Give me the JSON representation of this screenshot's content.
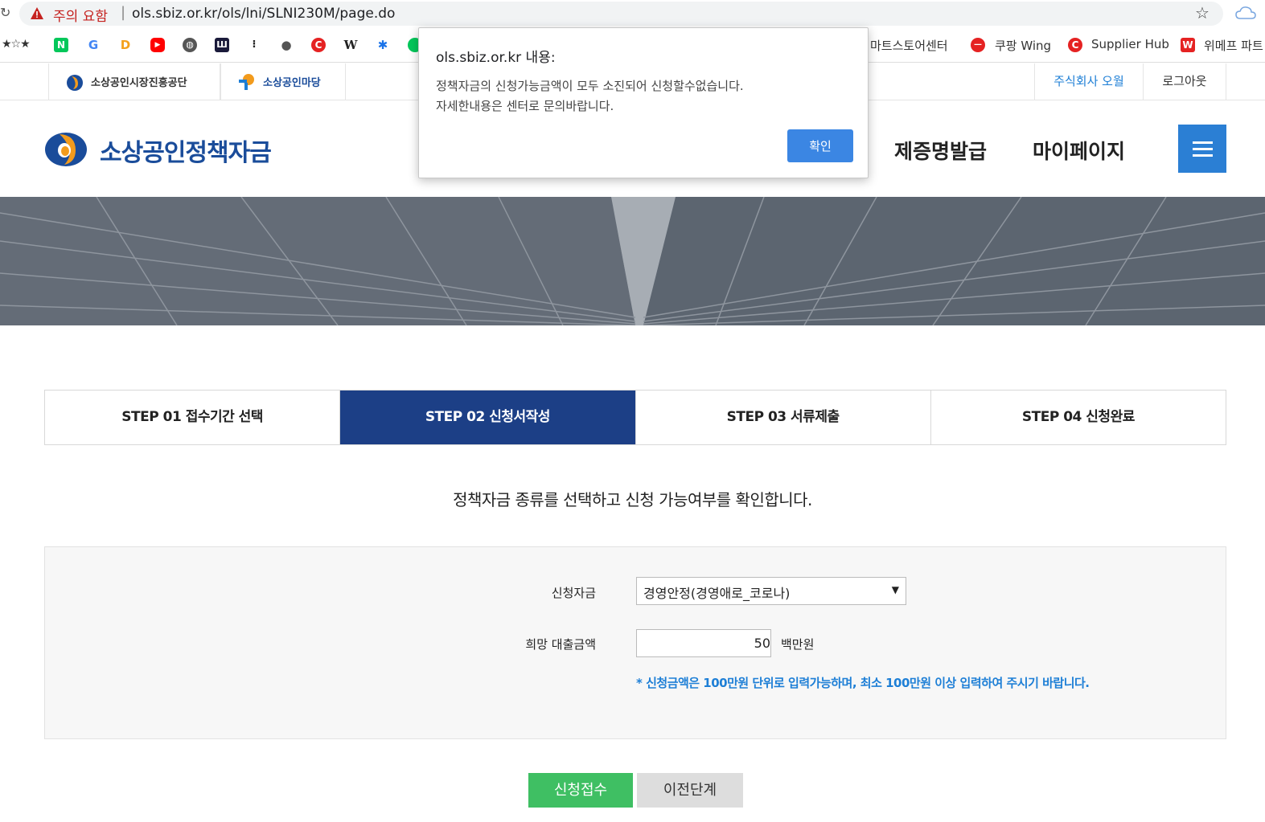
{
  "browser": {
    "security_warning": "주의 요함",
    "separator": "|",
    "url": "ols.sbiz.or.kr/ols/lni/SLNI230M/page.do"
  },
  "bookmarks": {
    "stars": "★☆★",
    "items": [
      {
        "label": "마트스토어센터"
      },
      {
        "label": "쿠팡 Wing"
      },
      {
        "label": "Supplier Hub"
      },
      {
        "label": "위메프 파트"
      }
    ]
  },
  "sitebar": {
    "org1": "소상공인시장진흥공단",
    "org2": "소상공인마당",
    "company": "주식회사 오월",
    "logout": "로그아웃"
  },
  "header": {
    "title": "소상공인정책자금",
    "nav": [
      "제증명발급",
      "마이페이지"
    ]
  },
  "steps": [
    {
      "label": "STEP 01 접수기간 선택",
      "active": false
    },
    {
      "label": "STEP 02 신청서작성",
      "active": true
    },
    {
      "label": "STEP 03 서류제출",
      "active": false
    },
    {
      "label": "STEP 04 신청완료",
      "active": false
    }
  ],
  "intro": "정책자금 종류를 선택하고 신청 가능여부를 확인합니다.",
  "form": {
    "fund_label": "신청자금",
    "fund_value": "경영안정(경영애로_코로나)",
    "amount_label": "희망 대출금액",
    "amount_value": "50",
    "amount_unit": "백만원",
    "notice": "* 신청금액은 100만원 단위로 입력가능하며, 최소 100만원 이상 입력하여 주시기 바랍니다."
  },
  "buttons": {
    "submit": "신청접수",
    "prev": "이전단계"
  },
  "dialog": {
    "title": "ols.sbiz.or.kr 내용:",
    "line1": "정책자금의 신청가능금액이 모두 소진되어 신청할수없습니다.",
    "line2": "자세한내용은 센터로 문의바랍니다.",
    "ok": "확인"
  },
  "colors": {
    "step_active": "#1c3f86",
    "menu_button": "#2b7fd4",
    "submit_button": "#3fbf63",
    "notice_text": "#1e7fd6",
    "dialog_ok": "#3b86e3"
  }
}
